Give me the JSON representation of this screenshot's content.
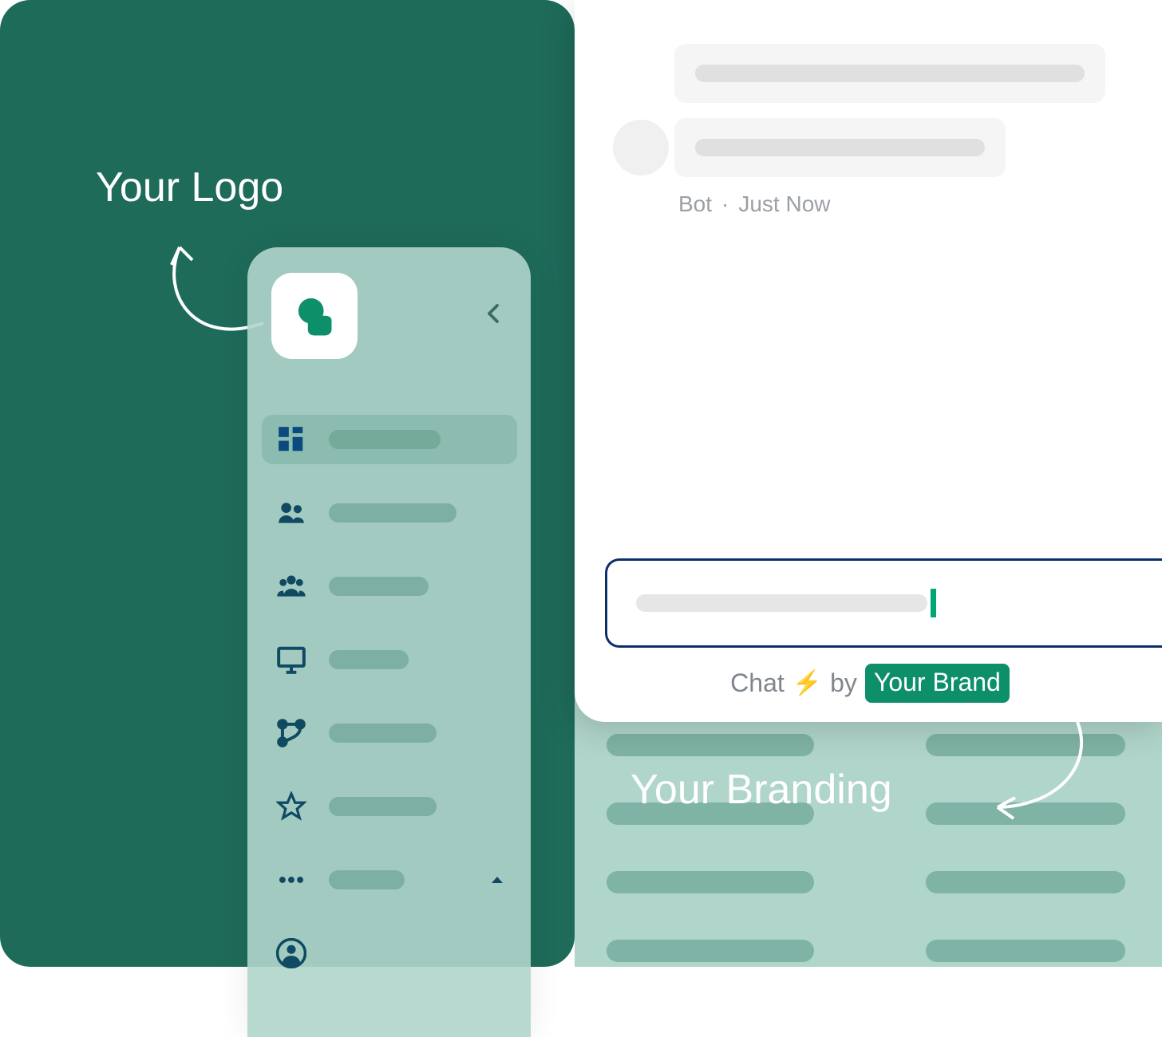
{
  "annotations": {
    "logo_label": "Your Logo",
    "branding_label": "Your Branding"
  },
  "chat": {
    "meta_sender": "Bot",
    "meta_time": "Just Now",
    "meta_separator": "·",
    "footer_chat": "Chat",
    "footer_by": "by",
    "footer_brand": "Your Brand"
  },
  "sidebar": {
    "nav_items": [
      {
        "icon": "dashboard",
        "active": true
      },
      {
        "icon": "people"
      },
      {
        "icon": "group"
      },
      {
        "icon": "monitor"
      },
      {
        "icon": "branches"
      },
      {
        "icon": "star"
      },
      {
        "icon": "more",
        "collapsible": true
      },
      {
        "icon": "account"
      }
    ]
  }
}
